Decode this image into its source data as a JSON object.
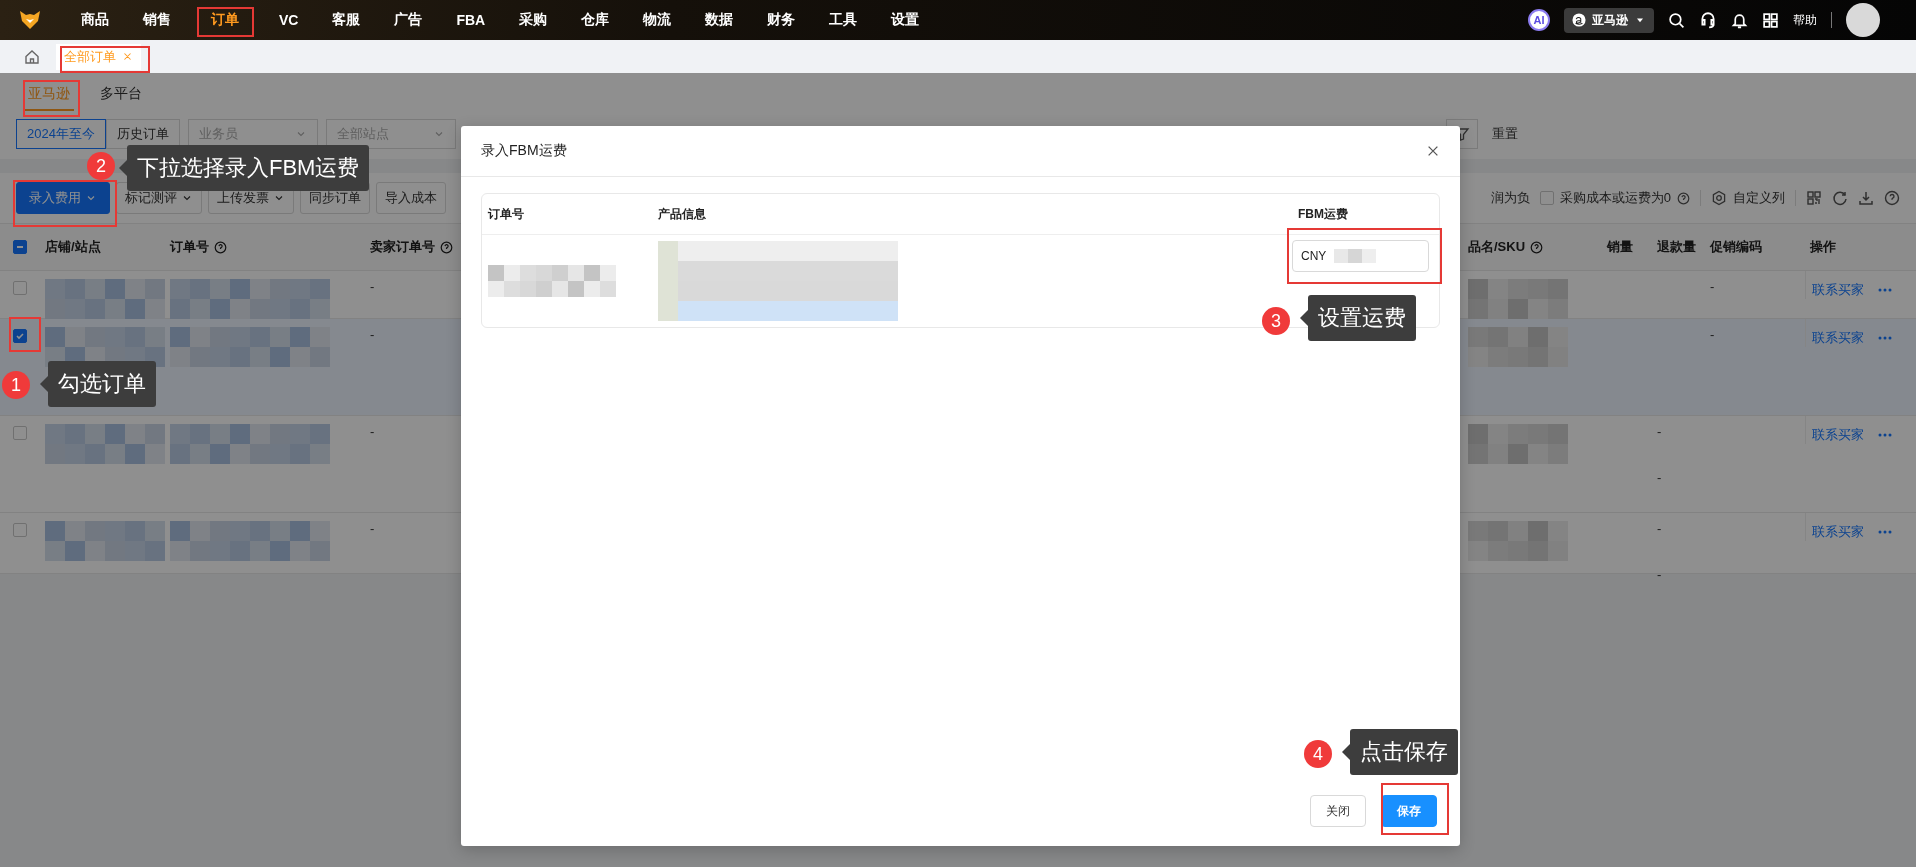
{
  "nav": {
    "items": [
      {
        "label": "商品",
        "selected": false
      },
      {
        "label": "销售",
        "selected": false
      },
      {
        "label": "订单",
        "selected": true
      },
      {
        "label": "VC",
        "selected": false
      },
      {
        "label": "客服",
        "selected": false
      },
      {
        "label": "广告",
        "selected": false
      },
      {
        "label": "FBA",
        "selected": false
      },
      {
        "label": "采购",
        "selected": false
      },
      {
        "label": "仓库",
        "selected": false
      },
      {
        "label": "物流",
        "selected": false
      },
      {
        "label": "数据",
        "selected": false
      },
      {
        "label": "财务",
        "selected": false
      },
      {
        "label": "工具",
        "selected": false
      },
      {
        "label": "设置",
        "selected": false
      }
    ],
    "ai_badge": "AI",
    "marketplace": "亚马逊",
    "help": "帮助"
  },
  "tabs": [
    {
      "label": "全部订单",
      "selected": true
    }
  ],
  "platform_tabs": [
    {
      "label": "亚马逊",
      "selected": true
    },
    {
      "label": "多平台",
      "selected": false
    }
  ],
  "filters": {
    "periods": [
      {
        "label": "2024年至今",
        "selected": true
      },
      {
        "label": "历史订单",
        "selected": false
      }
    ],
    "selects": [
      {
        "placeholder": "业务员"
      },
      {
        "placeholder": "全部站点"
      }
    ],
    "reset": "重置"
  },
  "actions": {
    "buttons": [
      {
        "label": "录入费用",
        "kind": "primary",
        "dropdown": true
      },
      {
        "label": "标记测评",
        "kind": "default",
        "dropdown": true
      },
      {
        "label": "上传发票",
        "kind": "default",
        "dropdown": true
      },
      {
        "label": "同步订单",
        "kind": "default",
        "dropdown": false
      },
      {
        "label": "导入成本",
        "kind": "default",
        "dropdown": false
      }
    ],
    "partial_label": "润为负",
    "cost_filter": {
      "label": "采购成本或运费为0",
      "checked": false
    },
    "customize_columns": "自定义列"
  },
  "table": {
    "select_all": {
      "indeterminate": true
    },
    "columns": [
      {
        "label": "店铺/站点",
        "help": false
      },
      {
        "label": "订单号",
        "help": true
      },
      {
        "label": "卖家订单号",
        "help": true
      },
      {
        "label": "品名/SKU",
        "help": true
      },
      {
        "label": "销量",
        "help": false
      },
      {
        "label": "退款量",
        "help": false
      },
      {
        "label": "促销编码",
        "help": false
      },
      {
        "label": "操作",
        "help": false
      }
    ],
    "rows": [
      {
        "checked": false,
        "seller_order_no": "-",
        "lines": [
          {
            "promo_code": "-"
          }
        ],
        "action": "联系买家"
      },
      {
        "checked": true,
        "seller_order_no": "-",
        "lines": [
          {
            "promo_code": "-"
          }
        ],
        "action": "联系买家"
      },
      {
        "checked": false,
        "seller_order_no": "-",
        "lines": [
          {
            "refund_qty": "-"
          },
          {
            "refund_qty": "-"
          }
        ],
        "action": "联系买家"
      },
      {
        "checked": false,
        "seller_order_no": "-",
        "lines": [
          {
            "refund_qty": "-"
          },
          {
            "refund_qty": "-"
          }
        ],
        "action": "联系买家"
      }
    ]
  },
  "modal": {
    "title": "录入FBM运费",
    "columns": [
      "订单号",
      "产品信息",
      "FBM运费"
    ],
    "rows": [
      {
        "currency": "CNY"
      }
    ],
    "buttons": [
      {
        "label": "关闭",
        "kind": "default"
      },
      {
        "label": "保存",
        "kind": "primary"
      }
    ]
  },
  "annotations": [
    {
      "number": "1",
      "text": "勾选订单"
    },
    {
      "number": "2",
      "text": "下拉选择录入FBM运费"
    },
    {
      "number": "3",
      "text": "设置运费"
    },
    {
      "number": "4",
      "text": "点击保存"
    }
  ]
}
